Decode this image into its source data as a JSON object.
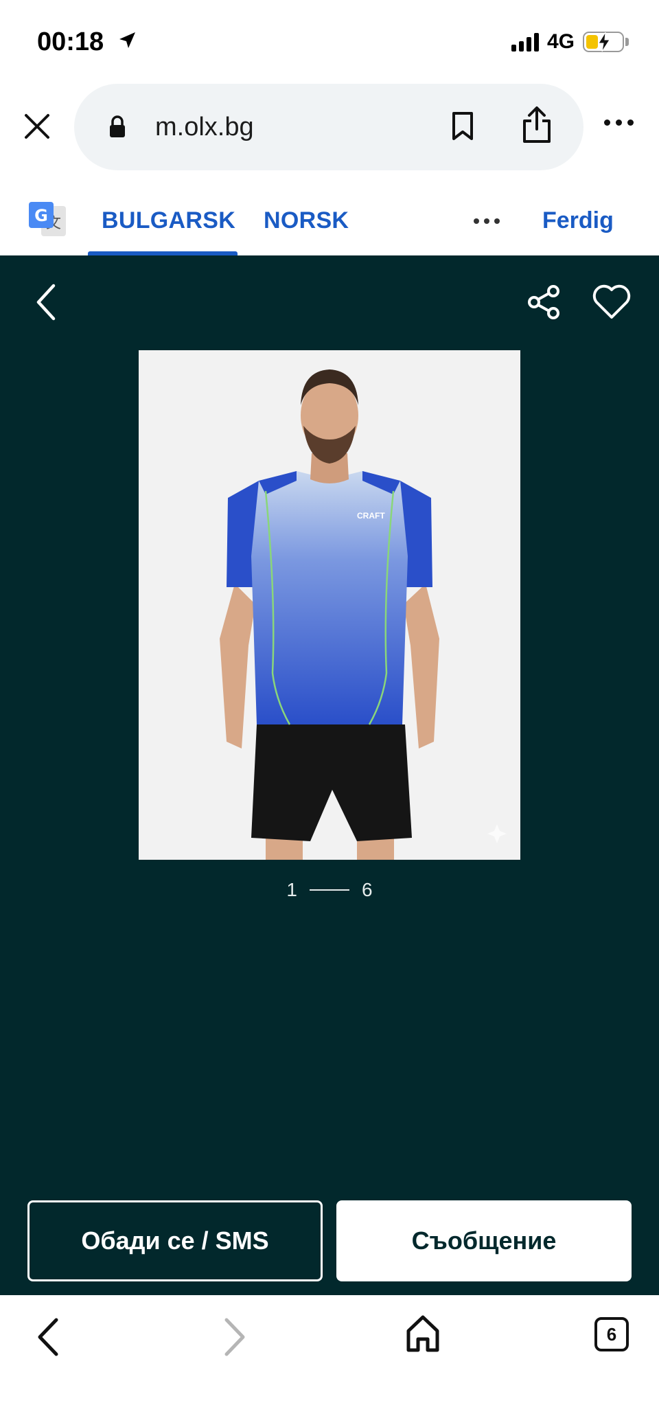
{
  "status_bar": {
    "time": "00:18",
    "network": "4G",
    "battery_level": 0.34
  },
  "browser": {
    "url": "m.olx.bg"
  },
  "translate_bar": {
    "tabs": [
      {
        "label": "BULGARSK",
        "selected": true
      },
      {
        "label": "NORSK",
        "selected": false
      }
    ],
    "done_label": "Ferdig"
  },
  "gallery": {
    "current_index": "1",
    "total": "6",
    "photo_brand": "CRAFT"
  },
  "actions": {
    "call_label": "Обади се / SMS",
    "message_label": "Съобщение"
  },
  "toolbar": {
    "tab_count": "6"
  },
  "colors": {
    "gallery_bg": "#02282c",
    "link_blue": "#1a5bc4",
    "shirt_blue": "#2a4fc9"
  }
}
